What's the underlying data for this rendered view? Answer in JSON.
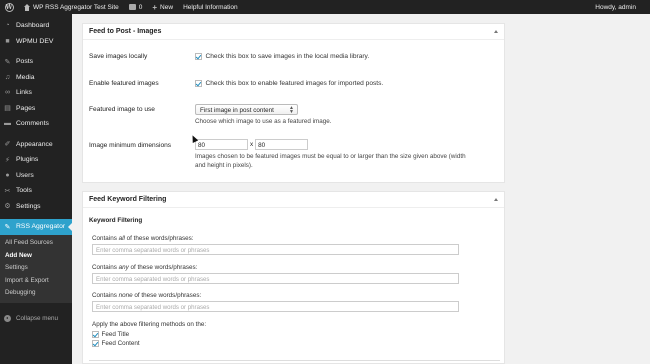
{
  "adminbar": {
    "site_name": "WP RSS Aggregator Test Site",
    "comments_count": "0",
    "new_label": "New",
    "helpful_info": "Helpful Information",
    "howdy": "Howdy, admin"
  },
  "sidebar": {
    "items": [
      {
        "label": "Dashboard",
        "icon": "dashboard-icon"
      },
      {
        "label": "WPMU DEV",
        "icon": "wpmudev-icon"
      },
      {
        "label": "Posts",
        "icon": "pin-icon"
      },
      {
        "label": "Media",
        "icon": "media-icon"
      },
      {
        "label": "Links",
        "icon": "links-icon"
      },
      {
        "label": "Pages",
        "icon": "pages-icon"
      },
      {
        "label": "Comments",
        "icon": "comments-icon"
      },
      {
        "label": "Appearance",
        "icon": "appearance-icon"
      },
      {
        "label": "Plugins",
        "icon": "plugins-icon"
      },
      {
        "label": "Users",
        "icon": "users-icon"
      },
      {
        "label": "Tools",
        "icon": "tools-icon"
      },
      {
        "label": "Settings",
        "icon": "settings-icon"
      },
      {
        "label": "RSS Aggregator",
        "icon": "pin-icon"
      }
    ],
    "submenu": [
      "All Feed Sources",
      "Add New",
      "Settings",
      "Import & Export",
      "Debugging"
    ],
    "collapse_label": "Collapse menu"
  },
  "images_box": {
    "title": "Feed to Post - Images",
    "save_images_label": "Save images locally",
    "save_images_text": "Check this box to save images in the local media library.",
    "featured_label": "Enable featured images",
    "featured_text": "Check this box to enable featured images for imported posts.",
    "featured_use_label": "Featured image to use",
    "featured_use_value": "First image in post content",
    "featured_use_desc": "Choose which image to use as a featured image.",
    "min_dim_label": "Image minimum dimensions",
    "min_width": "80",
    "min_x": "x",
    "min_height": "80",
    "min_dim_desc_1": "Images chosen to be featured images must be equal to or larger than the size given above (width",
    "min_dim_desc_2": "and height in pixels)."
  },
  "keyword_box": {
    "title": "Feed Keyword Filtering",
    "subtitle": "Keyword Filtering",
    "all_label_pre": "Contains ",
    "all_label_em": "all",
    "all_label_post": " of these words/phrases:",
    "any_label_pre": "Contains ",
    "any_label_em": "any",
    "any_label_post": " of these words/phrases:",
    "none_label_pre": "Contains ",
    "none_label_em": "none",
    "none_label_post": " of these words/phrases:",
    "placeholder": "Enter comma separated words or phrases",
    "apply_label": "Apply the above filtering methods on the:",
    "feed_title_label": "Feed Title",
    "feed_content_label": "Feed Content"
  },
  "colors": {
    "adminbar_bg": "#222222",
    "sidebar_bg": "#222222",
    "active_menu": "#2ea2cc",
    "page_bg": "#f1f1f1"
  }
}
